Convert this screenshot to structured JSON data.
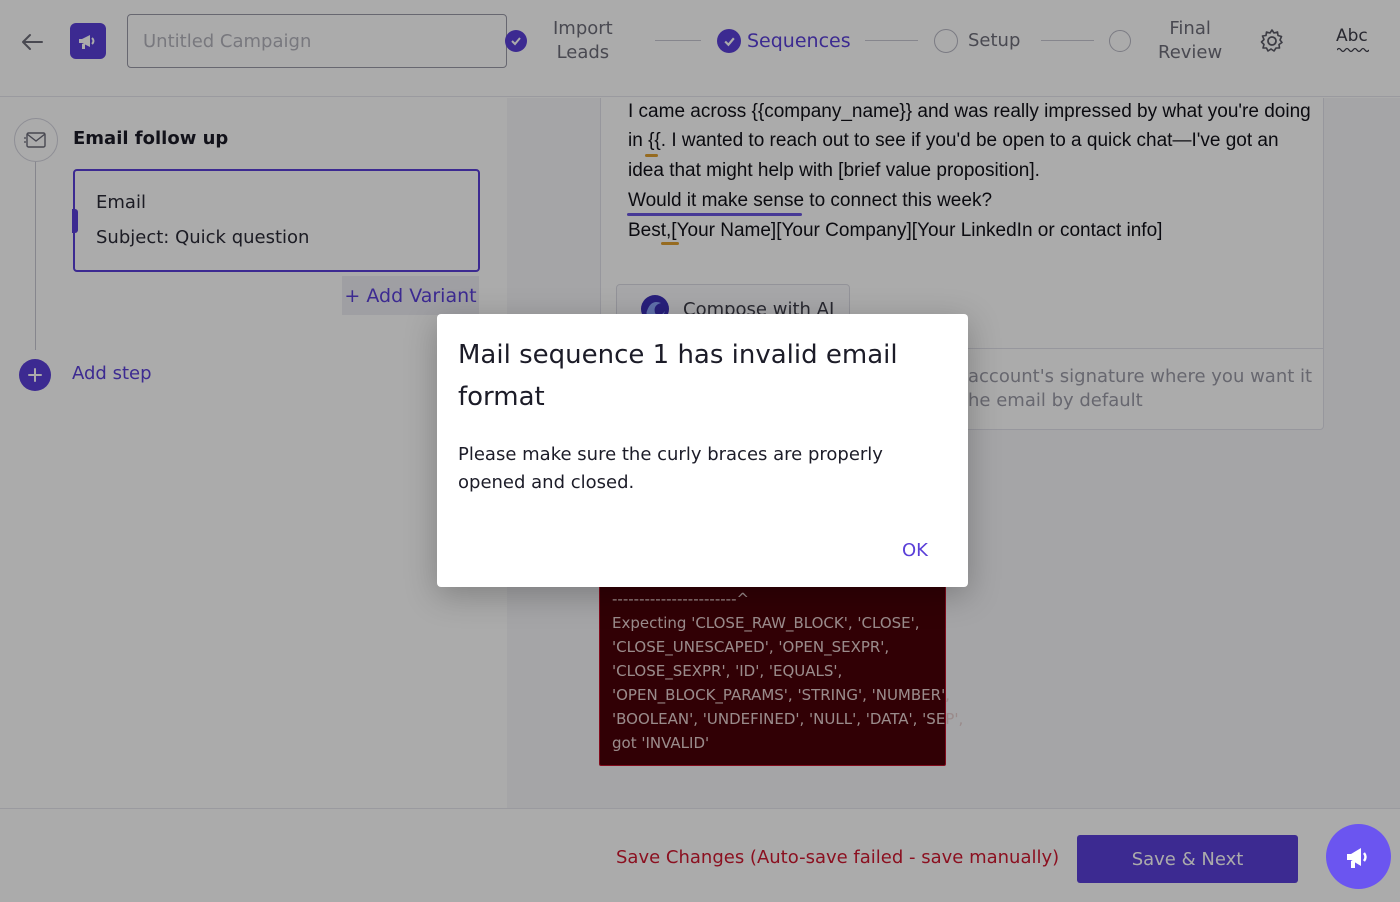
{
  "header": {
    "campaign_placeholder": "Untitled Campaign",
    "steps": [
      {
        "label_line1": "Import",
        "label_line2": "Leads",
        "state": "done"
      },
      {
        "label": "Sequences",
        "state": "active"
      },
      {
        "label": "Setup",
        "state": "pending"
      },
      {
        "label_line1": "Final",
        "label_line2": "Review",
        "state": "pending"
      }
    ],
    "abc_label": "Abc"
  },
  "sequence": {
    "title": "Email follow up",
    "card": {
      "type": "Email",
      "subject": "Subject: Quick question"
    },
    "add_variant": "+ Add Variant",
    "add_step": "Add step"
  },
  "editor": {
    "lines": [
      "I came across {{company_name}} and was really impressed by what you're doing",
      "in {{. I wanted to reach out to see if you'd be open to a quick chat—I've got an",
      "idea that might help with [brief value proposition].",
      "Would it make sense to connect this week?",
      "Best,[Your Name][Your Company][Your LinkedIn or contact info]"
    ],
    "compose_label": "Compose with AI",
    "signature_line1": "account's signature where you want it",
    "signature_line2": "he email by default"
  },
  "error": {
    "lines": [
      "-----------------------^",
      "Expecting 'CLOSE_RAW_BLOCK', 'CLOSE',",
      "'CLOSE_UNESCAPED', 'OPEN_SEXPR',",
      "'CLOSE_SEXPR', 'ID', 'EQUALS',",
      "'OPEN_BLOCK_PARAMS', 'STRING', 'NUMBER',",
      "'BOOLEAN', 'UNDEFINED', 'NULL', 'DATA', 'SEP',",
      "got 'INVALID'"
    ]
  },
  "footer": {
    "save_changes": "Save Changes (Auto-save failed - save manually)",
    "save_next": "Save & Next"
  },
  "dialog": {
    "title": "Mail sequence 1 has invalid email format",
    "body": "Please make sure the curly braces are properly opened and closed.",
    "ok": "OK"
  },
  "colors": {
    "accent": "#5a3fd8",
    "error_red": "#d01830",
    "error_bg": "#4a0008"
  },
  "icons": {
    "back": "arrow-left-icon",
    "logo": "megaphone-icon",
    "settings": "gear-icon",
    "mail": "envelope-icon",
    "add": "plus-icon",
    "compose": "ai-swirl-icon",
    "fab": "megaphone-icon"
  }
}
